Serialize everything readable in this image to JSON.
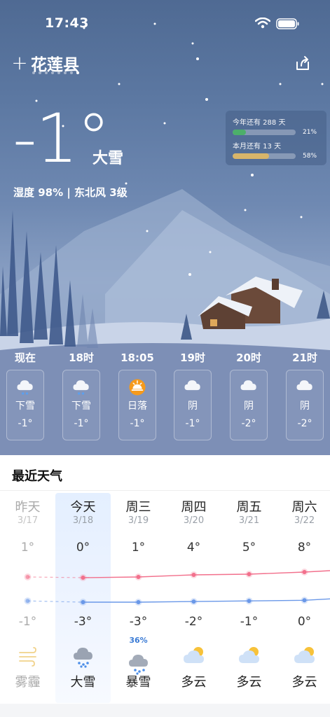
{
  "status_bar": {
    "time": "17:43"
  },
  "header": {
    "add_icon": "plus-icon",
    "city": "花莲县",
    "page_count": 8,
    "active_page": 7,
    "share_icon": "share-icon"
  },
  "current": {
    "temperature": "-1°",
    "condition": "大雪",
    "details": "湿度 98% | 东北风 3级"
  },
  "progress": [
    {
      "label": "今年还有 288 天",
      "percent": "21%",
      "value": 0.21,
      "color": "#4caf6a"
    },
    {
      "label": "本月还有 13 天",
      "percent": "58%",
      "value": 0.58,
      "color": "#d8b56a"
    }
  ],
  "hourly": [
    {
      "time": "现在",
      "icon": "snow-cloud-icon",
      "condition": "下雪",
      "temp": "-1°"
    },
    {
      "time": "18时",
      "icon": "snow-cloud-icon",
      "condition": "下雪",
      "temp": "-1°"
    },
    {
      "time": "18:05",
      "icon": "sunset-icon",
      "condition": "日落",
      "temp": "-1°"
    },
    {
      "time": "19时",
      "icon": "cloud-icon",
      "condition": "阴",
      "temp": "-1°"
    },
    {
      "time": "20时",
      "icon": "cloud-icon",
      "condition": "阴",
      "temp": "-2°"
    },
    {
      "time": "21时",
      "icon": "cloud-icon",
      "condition": "阴",
      "temp": "-2°"
    }
  ],
  "recent": {
    "title": "最近天气",
    "days": [
      {
        "name": "昨天",
        "date": "3/17",
        "high": "1°",
        "low": "-1°",
        "high_v": 1,
        "low_v": -1,
        "icon": "haze-icon",
        "condition": "雾霾",
        "precip": "",
        "past": true
      },
      {
        "name": "今天",
        "date": "3/18",
        "high": "0°",
        "low": "-3°",
        "high_v": 0,
        "low_v": -3,
        "icon": "heavy-snow-icon",
        "condition": "大雪",
        "precip": "",
        "past": false
      },
      {
        "name": "周三",
        "date": "3/19",
        "high": "1°",
        "low": "-3°",
        "high_v": 1,
        "low_v": -3,
        "icon": "blizzard-icon",
        "condition": "暴雪",
        "precip": "36%",
        "past": false
      },
      {
        "name": "周四",
        "date": "3/20",
        "high": "4°",
        "low": "-2°",
        "high_v": 4,
        "low_v": -2,
        "icon": "partly-cloudy-icon",
        "condition": "多云",
        "precip": "",
        "past": false
      },
      {
        "name": "周五",
        "date": "3/21",
        "high": "5°",
        "low": "-1°",
        "high_v": 5,
        "low_v": -1,
        "icon": "partly-cloudy-icon",
        "condition": "多云",
        "precip": "",
        "past": false
      },
      {
        "name": "周六",
        "date": "3/22",
        "high": "8°",
        "low": "0°",
        "high_v": 8,
        "low_v": 0,
        "icon": "partly-cloudy-icon",
        "condition": "多云",
        "precip": "",
        "past": false
      }
    ],
    "high_color": "#f2708c",
    "low_color": "#6a98e8"
  }
}
